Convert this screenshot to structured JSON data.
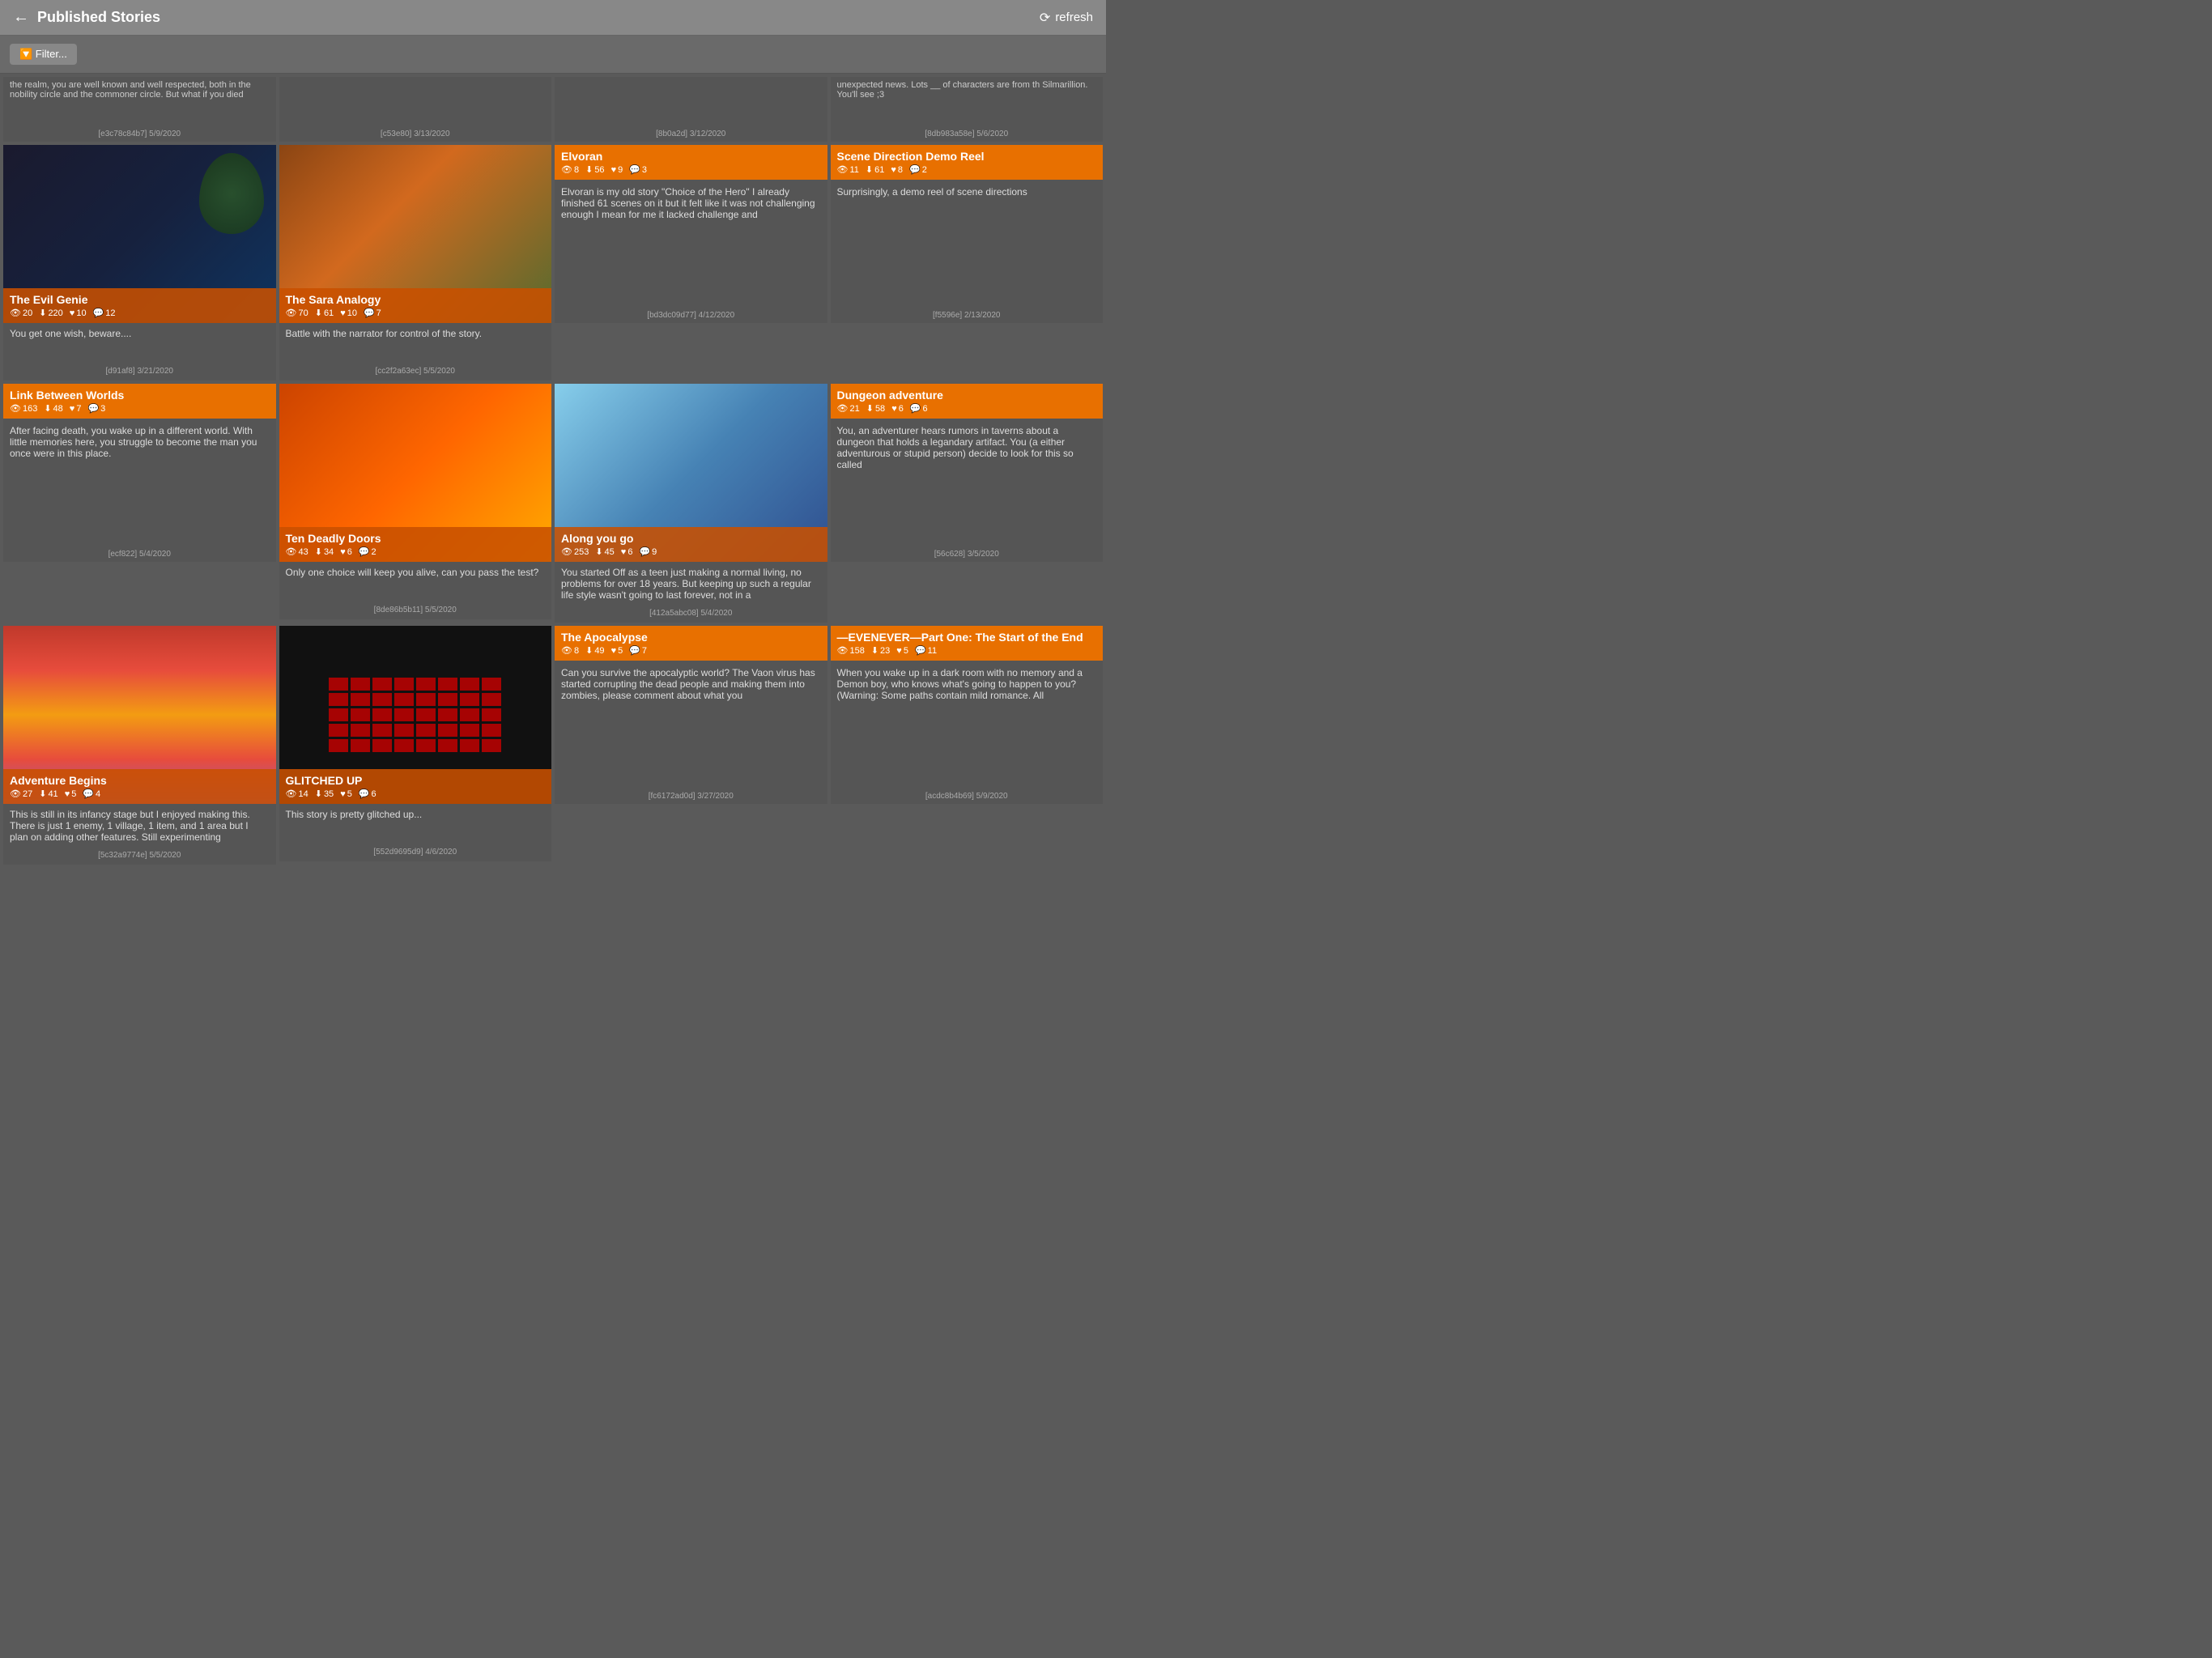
{
  "header": {
    "back_label": "←",
    "title": "Published Stories",
    "refresh_label": "refresh"
  },
  "filter": {
    "label": "🔽 Filter..."
  },
  "partial_cards": [
    {
      "id": "partial-1",
      "body_text": "the realm, you are well known and well respected, both in the nobility circle and the commoner circle. But what if you died",
      "footer": "[e3c78c84b7] 5/9/2020"
    },
    {
      "id": "partial-2",
      "body_text": "",
      "footer": "[c53e80] 3/13/2020"
    },
    {
      "id": "partial-3",
      "body_text": "",
      "footer": "[8b0a2d] 3/12/2020"
    },
    {
      "id": "partial-4",
      "body_text": "unexpected news. Lots __ of characters are from th Silmarillion. You'll see ;3",
      "footer": "[8db983a58e] 5/6/2020"
    }
  ],
  "cards": [
    {
      "id": "evil-genie",
      "type": "image",
      "title": "The Evil Genie",
      "stats": {
        "views": "20",
        "downloads": "220",
        "likes": "10",
        "comments": "12"
      },
      "body": "You get one wish, beware....",
      "footer": "[d91af8] 3/21/2020",
      "image_type": "bg-evil-genie"
    },
    {
      "id": "sara-analogy",
      "type": "image",
      "title": "The Sara Analogy",
      "stats": {
        "views": "70",
        "downloads": "61",
        "likes": "10",
        "comments": "7"
      },
      "body": "Battle with the narrator for control of the story.",
      "footer": "[cc2f2a63ec] 5/5/2020",
      "image_type": "bg-sara"
    },
    {
      "id": "elvoran",
      "type": "text",
      "title": "Elvoran",
      "stats": {
        "views": "8",
        "downloads": "56",
        "likes": "9",
        "comments": "3"
      },
      "body": "Elvoran is my old story \"Choice of the Hero\" I already finished 61 scenes on it but it felt like it was not challenging enough I mean for me it lacked challenge and",
      "footer": "[bd3dc09d77] 4/12/2020"
    },
    {
      "id": "scene-direction",
      "type": "text",
      "title": "Scene Direction Demo Reel",
      "stats": {
        "views": "11",
        "downloads": "61",
        "likes": "8",
        "comments": "2"
      },
      "body": "Surprisingly, a demo reel of scene directions",
      "footer": "[f5596e] 2/13/2020"
    },
    {
      "id": "link-between",
      "type": "text",
      "title": "Link Between Worlds",
      "stats": {
        "views": "163",
        "downloads": "48",
        "likes": "7",
        "comments": "3"
      },
      "body": "After facing death, you wake up in a different world. With little memories here, you struggle to become the man you once were in this place.",
      "footer": "[ecf822] 5/4/2020"
    },
    {
      "id": "ten-deadly",
      "type": "image",
      "title": "Ten Deadly Doors",
      "stats": {
        "views": "43",
        "downloads": "34",
        "likes": "6",
        "comments": "2"
      },
      "body": "Only one choice will keep you alive, can you pass the test?",
      "footer": "[8de86b5b11] 5/5/2020",
      "image_type": "bg-ten-doors"
    },
    {
      "id": "along-you-go",
      "type": "image",
      "title": "Along you go",
      "stats": {
        "views": "253",
        "downloads": "45",
        "likes": "6",
        "comments": "9"
      },
      "body": "You started Off as a teen just making a normal living, no problems for over 18 years. But keeping up such a regular life style wasn't going to last forever, not in a",
      "footer": "[412a5abc08] 5/4/2020",
      "image_type": "bg-along-you-go"
    },
    {
      "id": "dungeon",
      "type": "text",
      "title": "Dungeon adventure",
      "stats": {
        "views": "21",
        "downloads": "58",
        "likes": "6",
        "comments": "6"
      },
      "body": "You, an adventurer hears rumors in taverns about a dungeon that holds a legandary artifact. You (a either adventurous or stupid person) decide to look for this so called",
      "footer": "[56c628] 3/5/2020"
    },
    {
      "id": "adventure-begins",
      "type": "image",
      "title": "Adventure Begins",
      "stats": {
        "views": "27",
        "downloads": "41",
        "likes": "5",
        "comments": "4"
      },
      "body": "This is still in its infancy stage but I enjoyed making this. There is just 1 enemy, 1 village, 1 item, and 1 area but I plan on adding other features. Still experimenting",
      "footer": "[5c32a9774e] 5/5/2020",
      "image_type": "bg-adventure"
    },
    {
      "id": "glitched-up",
      "type": "image",
      "title": "GLITCHED UP",
      "stats": {
        "views": "14",
        "downloads": "35",
        "likes": "5",
        "comments": "6"
      },
      "body": "This story is pretty glitched up...",
      "footer": "[552d9695d9] 4/6/2020",
      "image_type": "bg-glitched"
    },
    {
      "id": "apocalypse",
      "type": "text",
      "title": "The Apocalypse",
      "stats": {
        "views": "8",
        "downloads": "49",
        "likes": "5",
        "comments": "7"
      },
      "body": "Can you survive the apocalyptic world? The Vaon virus has started corrupting the dead people and making them into zombies, please comment about what you",
      "footer": "[fc6172ad0d] 3/27/2020"
    },
    {
      "id": "evenever",
      "type": "text",
      "title": "—EVENEVER—Part One: The Start of the End",
      "stats": {
        "views": "158",
        "downloads": "23",
        "likes": "5",
        "comments": "11"
      },
      "body": "When you wake up in a dark room with no memory and a Demon boy, who knows what's going to happen to you? (Warning: Some paths contain mild romance. All",
      "footer": "[acdc8b4b69] 5/9/2020"
    }
  ]
}
